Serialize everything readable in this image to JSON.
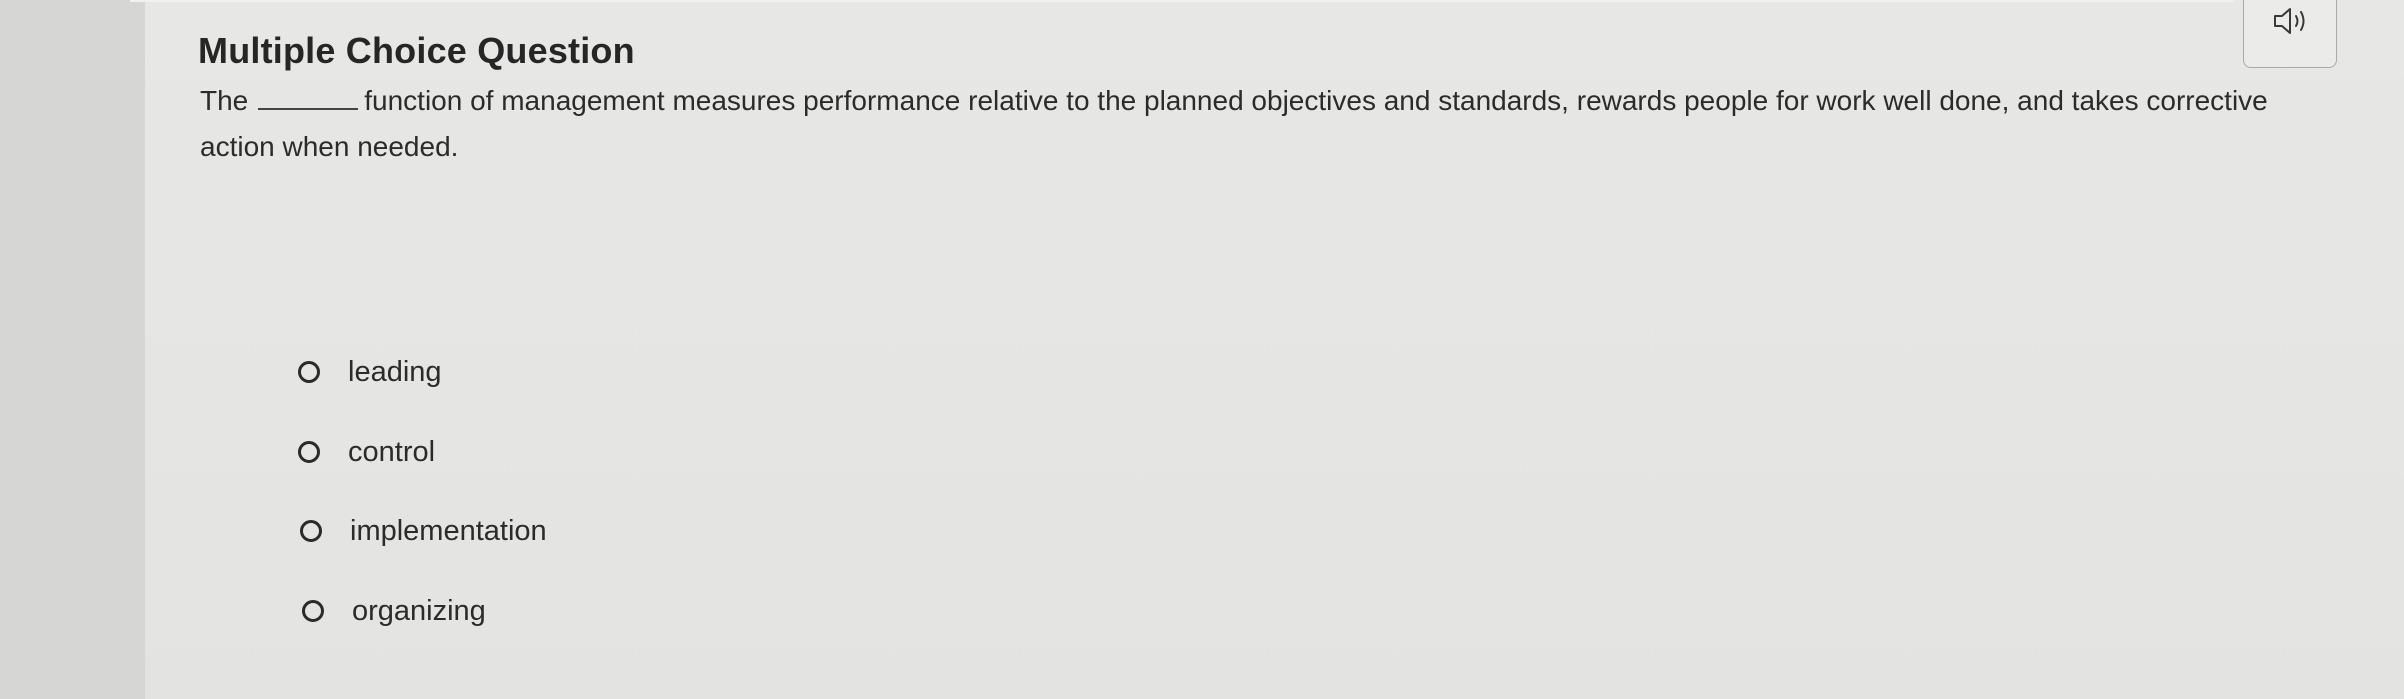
{
  "question": {
    "type_label": "Multiple Choice Question",
    "prompt_before": "The",
    "prompt_after": "function of management measures performance relative to the planned objectives and standards, rewards people for work well done, and takes corrective action when needed."
  },
  "audio_button": {
    "icon": "speaker-icon"
  },
  "options": [
    {
      "label": "leading"
    },
    {
      "label": "control"
    },
    {
      "label": "implementation"
    },
    {
      "label": "organizing"
    }
  ]
}
